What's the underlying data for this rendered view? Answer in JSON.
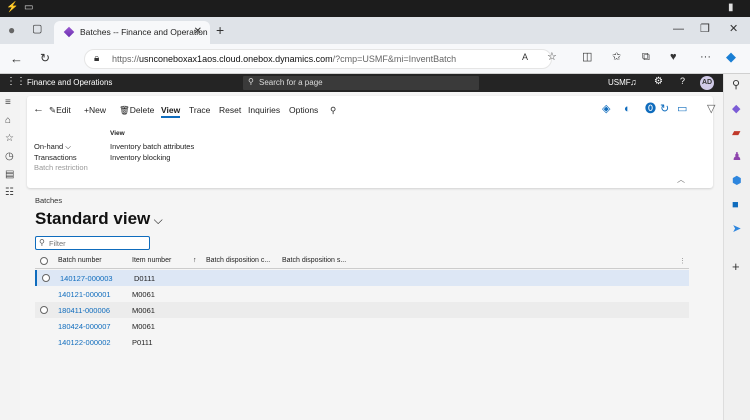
{
  "browser": {
    "tab_title": "Batches -- Finance and Operation",
    "url_prefix": "https://",
    "url_host": "usnconeboxax1aos.cloud.onebox.dynamics.com",
    "url_rest": "/?cmp=USMF&mi=InventBatch"
  },
  "app": {
    "name": "Finance and Operations",
    "search_placeholder": "Search for a page",
    "company": "USMF",
    "avatar_initials": "AD"
  },
  "actions": {
    "edit": "Edit",
    "new": "New",
    "delete": "Delete",
    "view": "View",
    "trace": "Trace",
    "reset": "Reset",
    "inquiries": "Inquiries",
    "options": "Options"
  },
  "view_group": {
    "title": "View",
    "onhand": "On-hand",
    "transactions": "Transactions",
    "batch_restriction": "Batch restriction",
    "inv_batch_attributes": "Inventory batch attributes",
    "inv_blocking": "Inventory blocking"
  },
  "page": {
    "section_label": "Batches",
    "view_title": "Standard view",
    "filter_placeholder": "Filter"
  },
  "grid": {
    "headers": [
      "Batch number",
      "Item number",
      "Batch disposition c...",
      "Batch disposition s..."
    ],
    "rows": [
      {
        "batch": "140127-000003",
        "item": "D0111"
      },
      {
        "batch": "140121-000001",
        "item": "M0061"
      },
      {
        "batch": "180411-000006",
        "item": "M0061"
      },
      {
        "batch": "180424-000007",
        "item": "M0061"
      },
      {
        "batch": "140122-000002",
        "item": "P0111"
      }
    ]
  },
  "colors": {
    "accent": "#0f6cbd",
    "app_header": "#242424",
    "selected_row": "#dde7f5"
  }
}
